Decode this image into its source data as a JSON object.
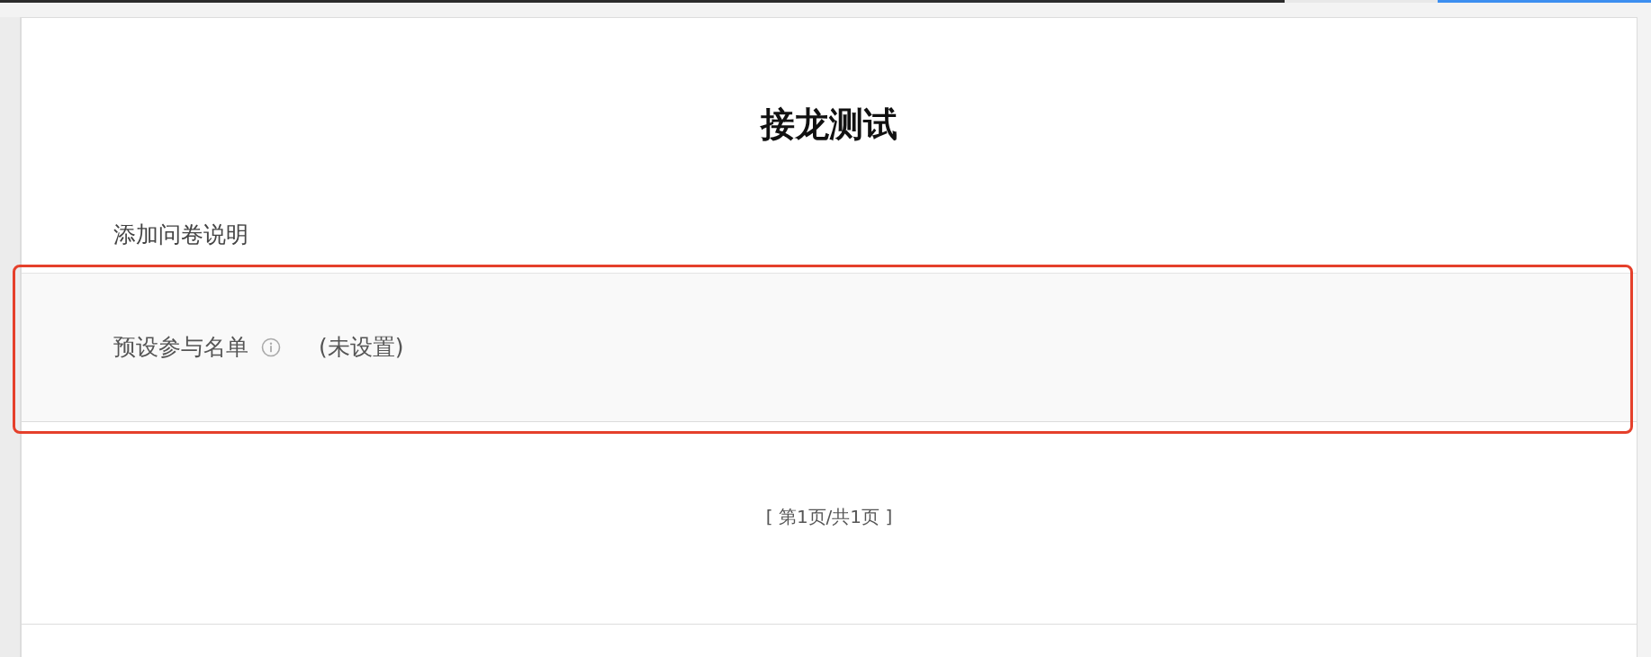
{
  "survey": {
    "title": "接龙测试",
    "description": "添加问卷说明"
  },
  "field": {
    "label": "预设参与名单",
    "value": "(未设置)"
  },
  "pager": "[ 第1页/共1页 ]"
}
